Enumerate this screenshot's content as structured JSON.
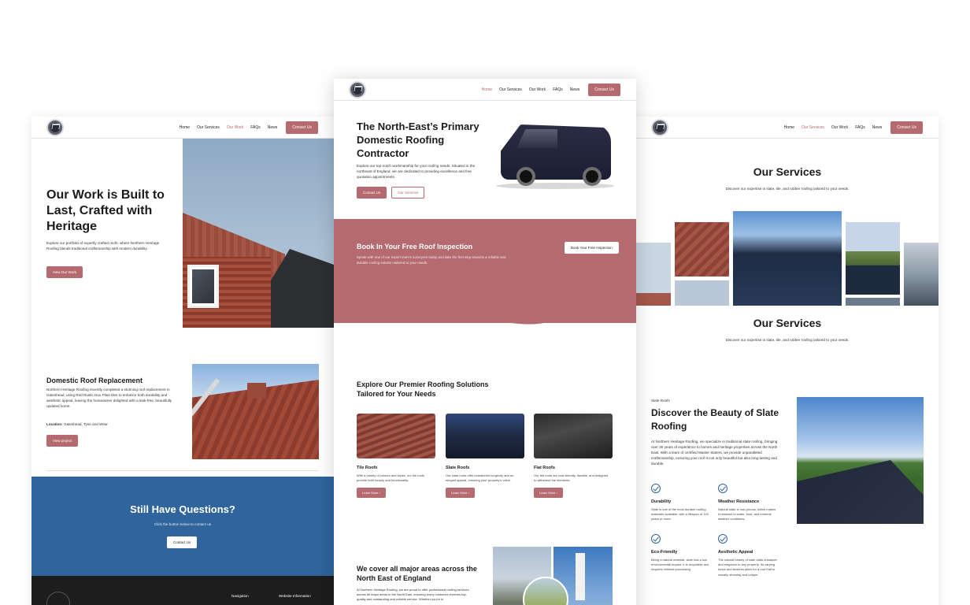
{
  "left": {
    "nav": {
      "links": [
        "Home",
        "Our Services",
        "Our Work",
        "FAQs",
        "News"
      ],
      "active": "Our Work",
      "cta": "Contact Us"
    },
    "hero": {
      "title": "Our Work is Built to Last, Crafted with Heritage",
      "body": "Explore our portfolio of expertly crafted roofs, where Northern Heritage Roofing blends traditional craftsmanship with modern durability.",
      "button": "View Our Work"
    },
    "project": {
      "title": "Domestic Roof Replacement",
      "body": "Northern Heritage Roofing recently completed a stunning roof replacement in Gateshead, using Red Rustic Duo Plain tiles to enhance both durability and aesthetic appeal, leaving the homeowner delighted with a leak-free, beautifully updated home.",
      "location_label": "Location:",
      "location_value": "Gateshead, Tyne and Wear",
      "button": "View project"
    },
    "questions": {
      "title": "Still Have Questions?",
      "subtitle": "Click the button below to contact us",
      "button": "Contact Us"
    },
    "footer": {
      "col1": "Navigation",
      "col2": "Website Information"
    }
  },
  "center": {
    "nav": {
      "links": [
        "Home",
        "Our Services",
        "Our Work",
        "FAQs",
        "News"
      ],
      "active": "Home",
      "cta": "Contact Us"
    },
    "hero": {
      "title": "The North-East’s Primary Domestic Roofing Contractor",
      "body": "Explore our top-notch workmanship for your roofing needs. Situated in the northeast of England, we are dedicated to providing excellence and free quotation appointments.",
      "btn_primary": "Contact Us",
      "btn_secondary": "Our Services"
    },
    "inspection": {
      "title": "Book In Your Free Roof Inspection",
      "body": "Speak with one of our expert team's surveyors today and take the first step towards a reliable and durable roofing solution tailored to your needs.",
      "button": "Book Your Free Inspection"
    },
    "solutions": {
      "title": "Explore Our Premier Roofing Solutions Tailored for Your Needs",
      "cards": [
        {
          "title": "Tile Roofs",
          "body": "With a variety of colours and styles, our tile roofs provide both beauty and functionality.",
          "button": "Learn More  ›",
          "image": "tile"
        },
        {
          "title": "Slate Roofs",
          "body": "Our slate roofs offer unmatched longevity and an elegant appeal, ensuring your property's value.",
          "button": "Learn More  ›",
          "image": "slate"
        },
        {
          "title": "Flat Roofs",
          "body": "Our felt roofs are cost-friendly, durable, and designed to withstand the elements.",
          "button": "Learn More  ›",
          "image": "flat"
        }
      ]
    },
    "coverage": {
      "title": "We cover all major areas across the North East of England",
      "body": "At Northern Heritage Roofing, we are proud to offer professional roofing services across all major areas in the North East, ensuring every customer receives top-quality and outstanding and reliable service. Whether you're in"
    }
  },
  "right": {
    "nav": {
      "links": [
        "Home",
        "Our Services",
        "Our Work",
        "FAQs",
        "News"
      ],
      "active": "Our Services",
      "cta": "Contact Us"
    },
    "services": {
      "title": "Our Services",
      "subtitle": "Discover our expertise in slate, tile, and rubber roofing tailored to your needs."
    },
    "services2": {
      "title": "Our Services",
      "subtitle": "Discover our expertise in slate, tile, and rubber roofing tailored to your needs."
    },
    "slate": {
      "kicker": "Slate Roofs",
      "title": "Discover the Beauty of Slate Roofing",
      "body": "At Northern Heritage Roofing, we specialize in traditional slate roofing, bringing over 25 years of experience to homes and heritage properties across the North East. With a team of certified Master Slaters, we provide unparalleled craftsmanship, ensuring your roof is not only beautiful but also long-lasting and durable.",
      "features": [
        {
          "title": "Durability",
          "body": "Slate is one of the most durable roofing materials available, with a lifespan of 100 years or more."
        },
        {
          "title": "Weather Resistance",
          "body": "Natural slate is non-porous, which makes it resistant to water, frost, and extreme weather conditions."
        },
        {
          "title": "Eco-Friendly",
          "body": "Being a natural material, slate has a low environmental impact. It is recyclable and requires minimal processing."
        },
        {
          "title": "Aesthetic Appeal",
          "body": "The natural beauty of slate adds character and elegance to any property. Its varying tones and textures allow for a roof that is visually stunning and unique."
        }
      ]
    }
  },
  "colors": {
    "accent": "#b46a6e",
    "blue": "#2f659c",
    "dark_footer": "#1d1d1d"
  }
}
